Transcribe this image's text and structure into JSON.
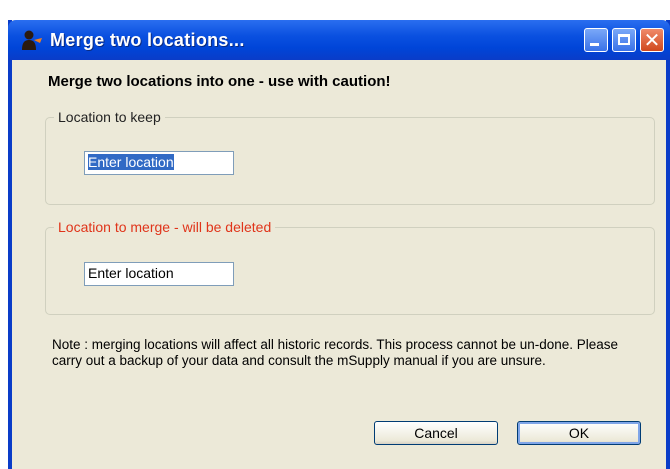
{
  "window": {
    "title": "Merge two locations...",
    "icon": "msupply-person-icon"
  },
  "heading": "Merge two locations into one - use with caution!",
  "keep_group": {
    "legend": "Location to keep",
    "input_value": "Enter location"
  },
  "merge_group": {
    "legend": "Location to merge - will be deleted",
    "input_value": "Enter location"
  },
  "note": "Note : merging locations will affect all historic records. This process cannot be un-done.  Please carry out a backup of your data and  consult the mSupply manual if you are unsure.",
  "buttons": {
    "cancel": "Cancel",
    "ok": "OK"
  },
  "colors": {
    "titlebar": "#0a50e0",
    "warning": "#e0341a",
    "dialog_bg": "#ece9d8",
    "selection": "#316ac5"
  }
}
